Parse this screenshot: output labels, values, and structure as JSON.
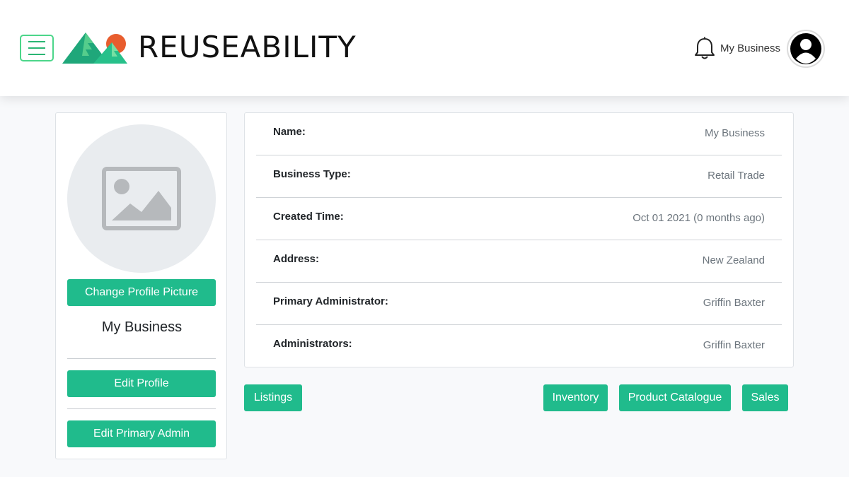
{
  "header": {
    "brand": "REUSEABILITY",
    "user_name": "My Business",
    "colors": {
      "accent": "#20bb8c",
      "menu_border": "#4cd68a",
      "sun": "#e85d2e"
    }
  },
  "profile": {
    "name": "My Business",
    "change_picture_label": "Change Profile Picture",
    "edit_profile_label": "Edit Profile",
    "edit_admin_label": "Edit Primary Admin"
  },
  "details": [
    {
      "label": "Name:",
      "value": "My Business"
    },
    {
      "label": "Business Type:",
      "value": "Retail Trade"
    },
    {
      "label": "Created Time:",
      "value": "Oct 01 2021 (0 months ago)"
    },
    {
      "label": "Address:",
      "value": "New Zealand"
    },
    {
      "label": "Primary Administrator:",
      "value": "Griffin Baxter"
    },
    {
      "label": "Administrators:",
      "value": "Griffin Baxter"
    }
  ],
  "actions": {
    "listings": "Listings",
    "inventory": "Inventory",
    "product_catalogue": "Product Catalogue",
    "sales": "Sales"
  },
  "icons": [
    "menu-icon",
    "logo-mountains-icon",
    "bell-icon",
    "user-avatar-icon",
    "image-placeholder-icon"
  ]
}
